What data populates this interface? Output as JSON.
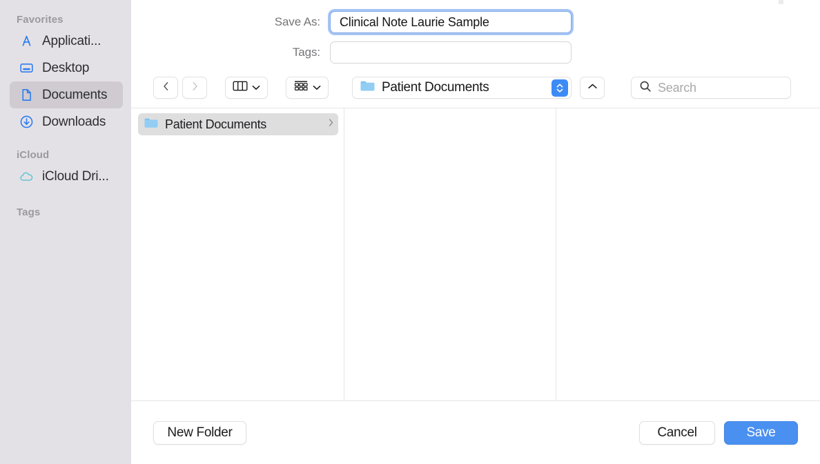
{
  "sidebar": {
    "sections": [
      {
        "title": "Favorites",
        "items": [
          {
            "label": "Applicati...",
            "icon": "applications-icon",
            "selected": false
          },
          {
            "label": "Desktop",
            "icon": "desktop-icon",
            "selected": false
          },
          {
            "label": "Documents",
            "icon": "document-icon",
            "selected": true
          },
          {
            "label": "Downloads",
            "icon": "downloads-icon",
            "selected": false
          }
        ]
      },
      {
        "title": "iCloud",
        "items": [
          {
            "label": "iCloud Dri...",
            "icon": "icloud-icon",
            "selected": false
          }
        ]
      },
      {
        "title": "Tags",
        "items": []
      }
    ]
  },
  "form": {
    "save_as_label": "Save As:",
    "save_as_value": "Clinical Note Laurie Sample",
    "tags_label": "Tags:",
    "tags_value": "",
    "tags_placeholder": ""
  },
  "toolbar": {
    "back_icon": "chevron-left-icon",
    "forward_icon": "chevron-right-icon",
    "view_mode_icon": "column-view-icon",
    "view_mode_chevron": "chevron-down-icon",
    "group_icon": "group-by-icon",
    "group_chevron": "chevron-down-icon",
    "path_label": "Patient Documents",
    "path_folder_icon": "folder-icon",
    "path_stepper_icon": "up-down-chevron-icon",
    "up_icon": "chevron-up-icon",
    "search_icon": "search-icon",
    "search_placeholder": "Search",
    "search_value": ""
  },
  "browser": {
    "columns": [
      {
        "rows": [
          {
            "name": "Patient Documents",
            "icon": "folder-icon",
            "selected": true,
            "disclosure": "chevron-right-icon"
          }
        ]
      },
      {
        "rows": []
      },
      {
        "rows": []
      }
    ]
  },
  "footer": {
    "new_folder_label": "New Folder",
    "cancel_label": "Cancel",
    "save_label": "Save"
  },
  "colors": {
    "accent": "#4a90f0",
    "sidebar_bg": "#e4e1e6",
    "selection": "#cfcbd1",
    "folder_blue": "#6cb8ef",
    "icon_blue": "#2a7df0",
    "icloud_teal": "#5bc4d4"
  }
}
